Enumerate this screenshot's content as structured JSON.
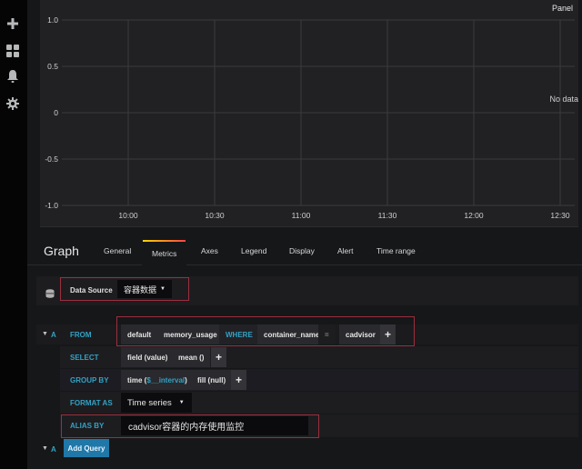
{
  "sidebar": {
    "items": [
      {
        "icon": "plus-icon",
        "label": "Create"
      },
      {
        "icon": "dashboards-icon",
        "label": "Dashboards"
      },
      {
        "icon": "bell-icon",
        "label": "Alerting"
      },
      {
        "icon": "gear-icon",
        "label": "Configuration"
      }
    ]
  },
  "panel": {
    "title": "Panel",
    "no_data": "No data",
    "y_ticks": [
      "1.0",
      "0.5",
      "0",
      "-0.5",
      "-1.0"
    ],
    "x_ticks": [
      "10:00",
      "10:30",
      "11:00",
      "11:30",
      "12:00",
      "12:30"
    ]
  },
  "editor": {
    "title": "Graph",
    "tabs": [
      {
        "label": "General",
        "active": false
      },
      {
        "label": "Metrics",
        "active": true
      },
      {
        "label": "Axes",
        "active": false
      },
      {
        "label": "Legend",
        "active": false
      },
      {
        "label": "Display",
        "active": false
      },
      {
        "label": "Alert",
        "active": false
      },
      {
        "label": "Time range",
        "active": false
      }
    ],
    "datasource": {
      "label": "Data Source",
      "value": "容器数据"
    },
    "query": {
      "ref": "A",
      "from": {
        "label": "FROM",
        "policy": "default",
        "measurement": "memory_usage",
        "where_label": "WHERE",
        "where_key": "container_name",
        "where_op": "=",
        "where_value": "cadvisor"
      },
      "select": {
        "label": "SELECT",
        "field": "field (value)",
        "fn": "mean ()"
      },
      "group_by": {
        "label": "GROUP BY",
        "time_prefix": "time (",
        "time_var": "$__interval",
        "time_suffix": ")",
        "fill": "fill (null)"
      },
      "format_as": {
        "label": "FORMAT AS",
        "value": "Time series"
      },
      "alias_by": {
        "label": "ALIAS BY",
        "value": "cadvisor容器的内存使用监控"
      }
    },
    "add_query": {
      "ref": "A",
      "label": "Add Query"
    },
    "plus_symbol": "+"
  },
  "colors": {
    "highlight_border": "#9b2f3e",
    "keyword": "#33a2c4",
    "add_query_bg": "#1f78a8"
  }
}
